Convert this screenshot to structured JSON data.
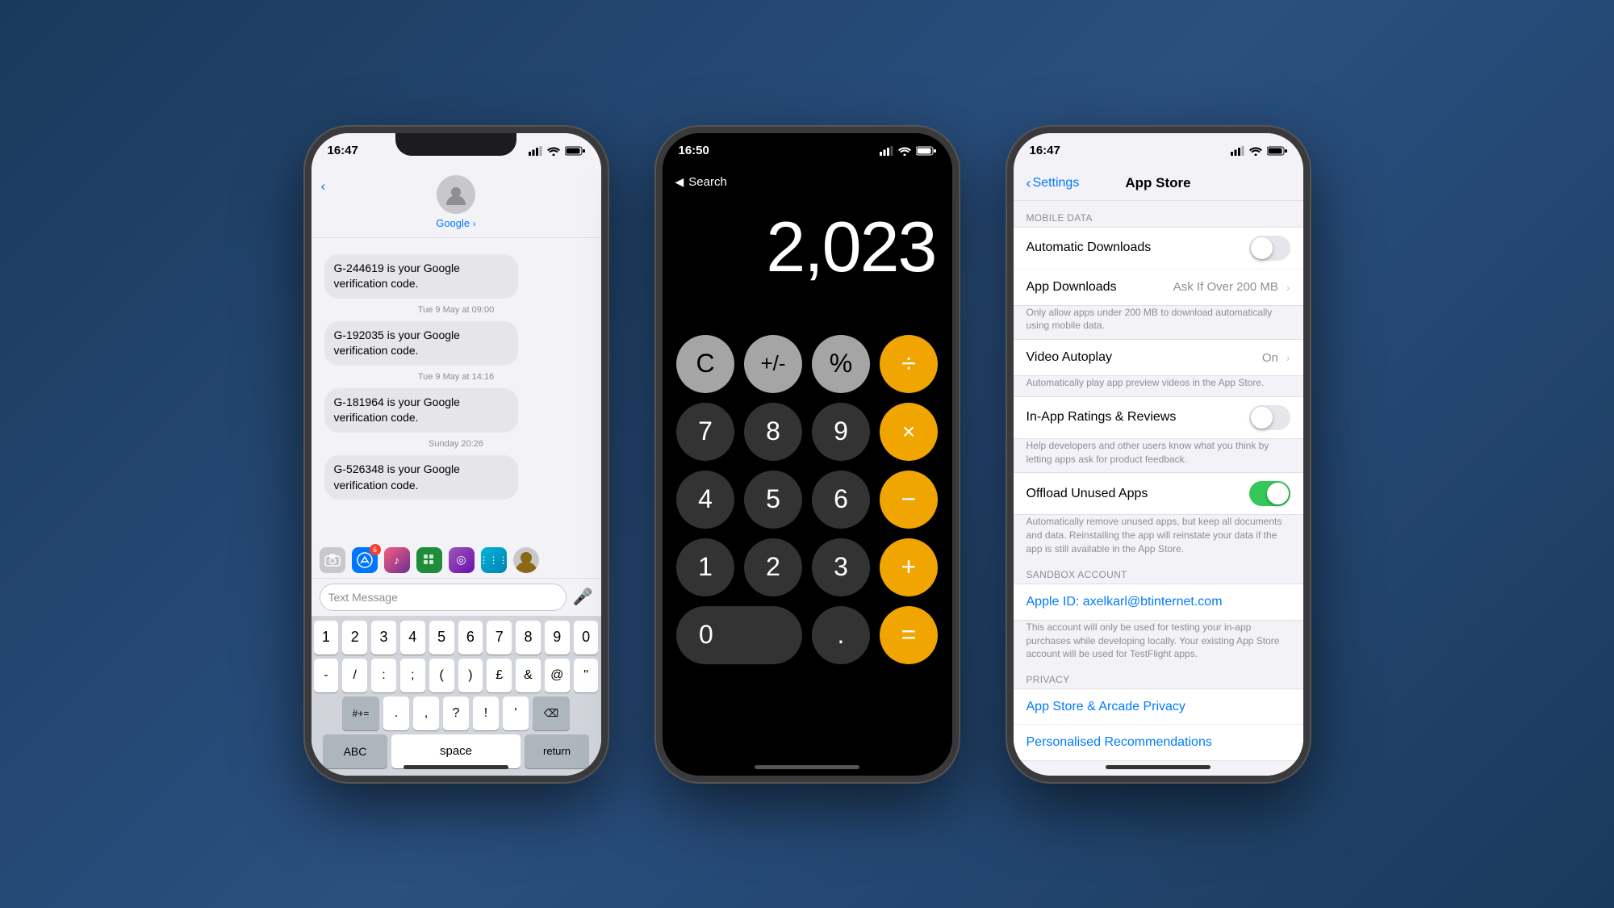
{
  "background": "#2a4a6b",
  "phones": {
    "messages": {
      "status_time": "16:47",
      "contact": "Google",
      "messages": [
        {
          "text": "G-244619 is your Google verification code.",
          "timestamp": null
        },
        {
          "timestamp": "Tue 9 May at 09:00"
        },
        {
          "text": "G-192035 is your Google verification code.",
          "timestamp": null
        },
        {
          "timestamp": "Tue 9 May at 14:16"
        },
        {
          "text": "G-181964 is your Google verification code.",
          "timestamp": null
        },
        {
          "timestamp": "Sunday 20:26"
        },
        {
          "text": "G-526348 is your Google verification code.",
          "timestamp": null
        }
      ],
      "input_placeholder": "Text Message",
      "keyboard": {
        "row1": [
          "1",
          "2",
          "3",
          "4",
          "5",
          "6",
          "7",
          "8",
          "9",
          "0"
        ],
        "row2": [
          "-",
          "/",
          ":",
          ";",
          "(",
          ")",
          "£",
          "&",
          "@",
          "\""
        ],
        "row3_left": "#+=",
        "row3_keys": [
          ".",
          ",",
          "?",
          "!",
          "'"
        ],
        "row4": [
          "ABC",
          "space",
          "return"
        ]
      },
      "app_icons": [
        "photos",
        "appstore",
        "music",
        "numbers",
        "podcasts",
        "siri",
        "avatar"
      ]
    },
    "calculator": {
      "status_time": "16:50",
      "back_label": "Search",
      "display": "2,023",
      "buttons": [
        [
          "C",
          "+/-",
          "%",
          "÷"
        ],
        [
          "7",
          "8",
          "9",
          "×"
        ],
        [
          "4",
          "5",
          "6",
          "−"
        ],
        [
          "1",
          "2",
          "3",
          "+"
        ],
        [
          "0",
          ".",
          "="
        ]
      ]
    },
    "appstore": {
      "status_time": "16:47",
      "back_label": "Settings",
      "title": "App Store",
      "sections": {
        "mobile_data_label": "MOBILE DATA",
        "automatic_downloads_label": "Automatic Downloads",
        "automatic_downloads_enabled": false,
        "app_downloads_label": "App Downloads",
        "app_downloads_value": "Ask If Over 200 MB",
        "app_downloads_desc": "Only allow apps under 200 MB to download automatically using mobile data.",
        "video_autoplay_label": "Video Autoplay",
        "video_autoplay_value": "On",
        "video_autoplay_desc": "Automatically play app preview videos in the App Store.",
        "in_app_ratings_label": "In-App Ratings & Reviews",
        "in_app_ratings_enabled": false,
        "in_app_ratings_desc": "Help developers and other users know what you think by letting apps ask for product feedback.",
        "offload_label": "Offload Unused Apps",
        "offload_enabled": true,
        "offload_desc": "Automatically remove unused apps, but keep all documents and data. Reinstalling the app will reinstate your data if the app is still available in the App Store.",
        "sandbox_label": "SANDBOX ACCOUNT",
        "apple_id_label": "Apple ID: axelkarl@btinternet.com",
        "apple_id_desc": "This account will only be used for testing your in-app purchases while developing locally. Your existing App Store account will be used for TestFlight apps.",
        "privacy_label": "PRIVACY",
        "arcade_privacy_label": "App Store & Arcade Privacy",
        "personalised_label": "Personalised Recommendations"
      }
    }
  }
}
